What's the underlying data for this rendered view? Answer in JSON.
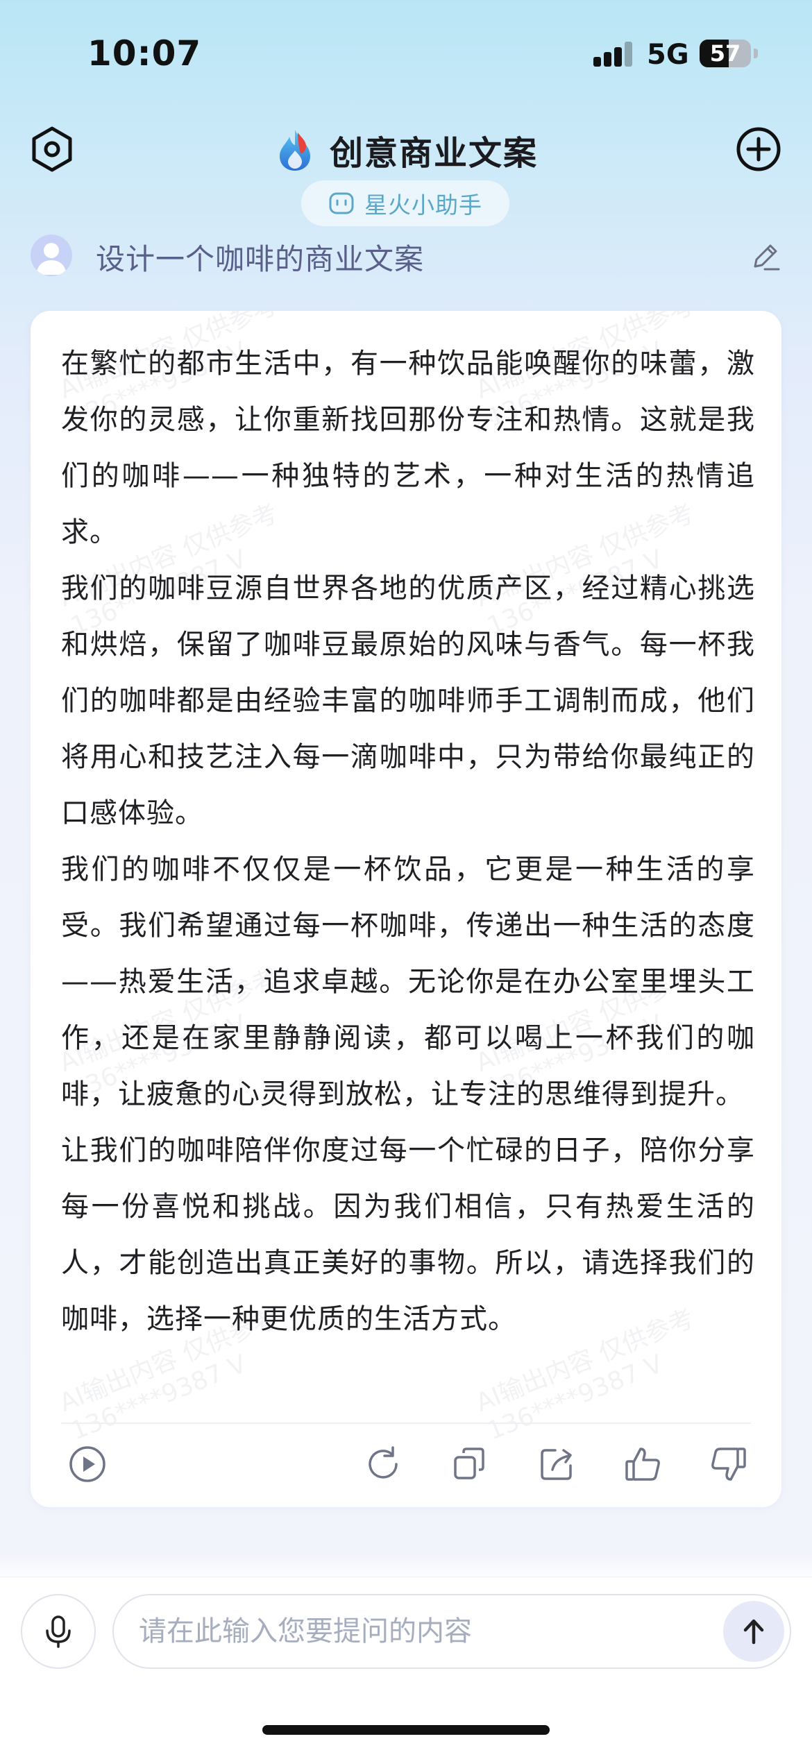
{
  "status_bar": {
    "time": "10:07",
    "network": "5G",
    "battery": "57",
    "battery_level_percent": 57
  },
  "header": {
    "title": "创意商业文案",
    "assistant_label": "星火小助手",
    "icons": {
      "left": "settings-hexagon-icon",
      "right": "plus-circle-icon",
      "logo": "spark-flame-logo"
    }
  },
  "question": {
    "text": "设计一个咖啡的商业文案"
  },
  "answer": {
    "paragraphs": [
      "在繁忙的都市生活中，有一种饮品能唤醒你的味蕾，激发你的灵感，让你重新找回那份专注和热情。这就是我们的咖啡——一种独特的艺术，一种对生活的热情追求。",
      "我们的咖啡豆源自世界各地的优质产区，经过精心挑选和烘焙，保留了咖啡豆最原始的风味与香气。每一杯我们的咖啡都是由经验丰富的咖啡师手工调制而成，他们将用心和技艺注入每一滴咖啡中，只为带给你最纯正的口感体验。",
      "我们的咖啡不仅仅是一杯饮品，它更是一种生活的享受。我们希望通过每一杯咖啡，传递出一种生活的态度——热爱生活，追求卓越。无论你是在办公室里埋头工作，还是在家里静静阅读，都可以喝上一杯我们的咖啡，让疲惫的心灵得到放松，让专注的思维得到提升。",
      "让我们的咖啡陪伴你度过每一个忙碌的日子，陪你分享每一份喜悦和挑战。因为我们相信，只有热爱生活的人，才能创造出真正美好的事物。所以，请选择我们的咖啡，选择一种更优质的生活方式。"
    ],
    "watermark": {
      "line1": "AI输出内容 仅供参考",
      "line2": "136****9387 V"
    },
    "actions": [
      "play-icon",
      "regenerate-icon",
      "copy-icon",
      "share-icon",
      "thumbs-up-icon",
      "thumbs-down-icon"
    ]
  },
  "input": {
    "placeholder": "请在此输入您要提问的内容",
    "value": ""
  },
  "colors": {
    "accent": "#5aa7c8",
    "question_text": "#5a5f8a",
    "icon_gray": "#8a8fa3"
  }
}
